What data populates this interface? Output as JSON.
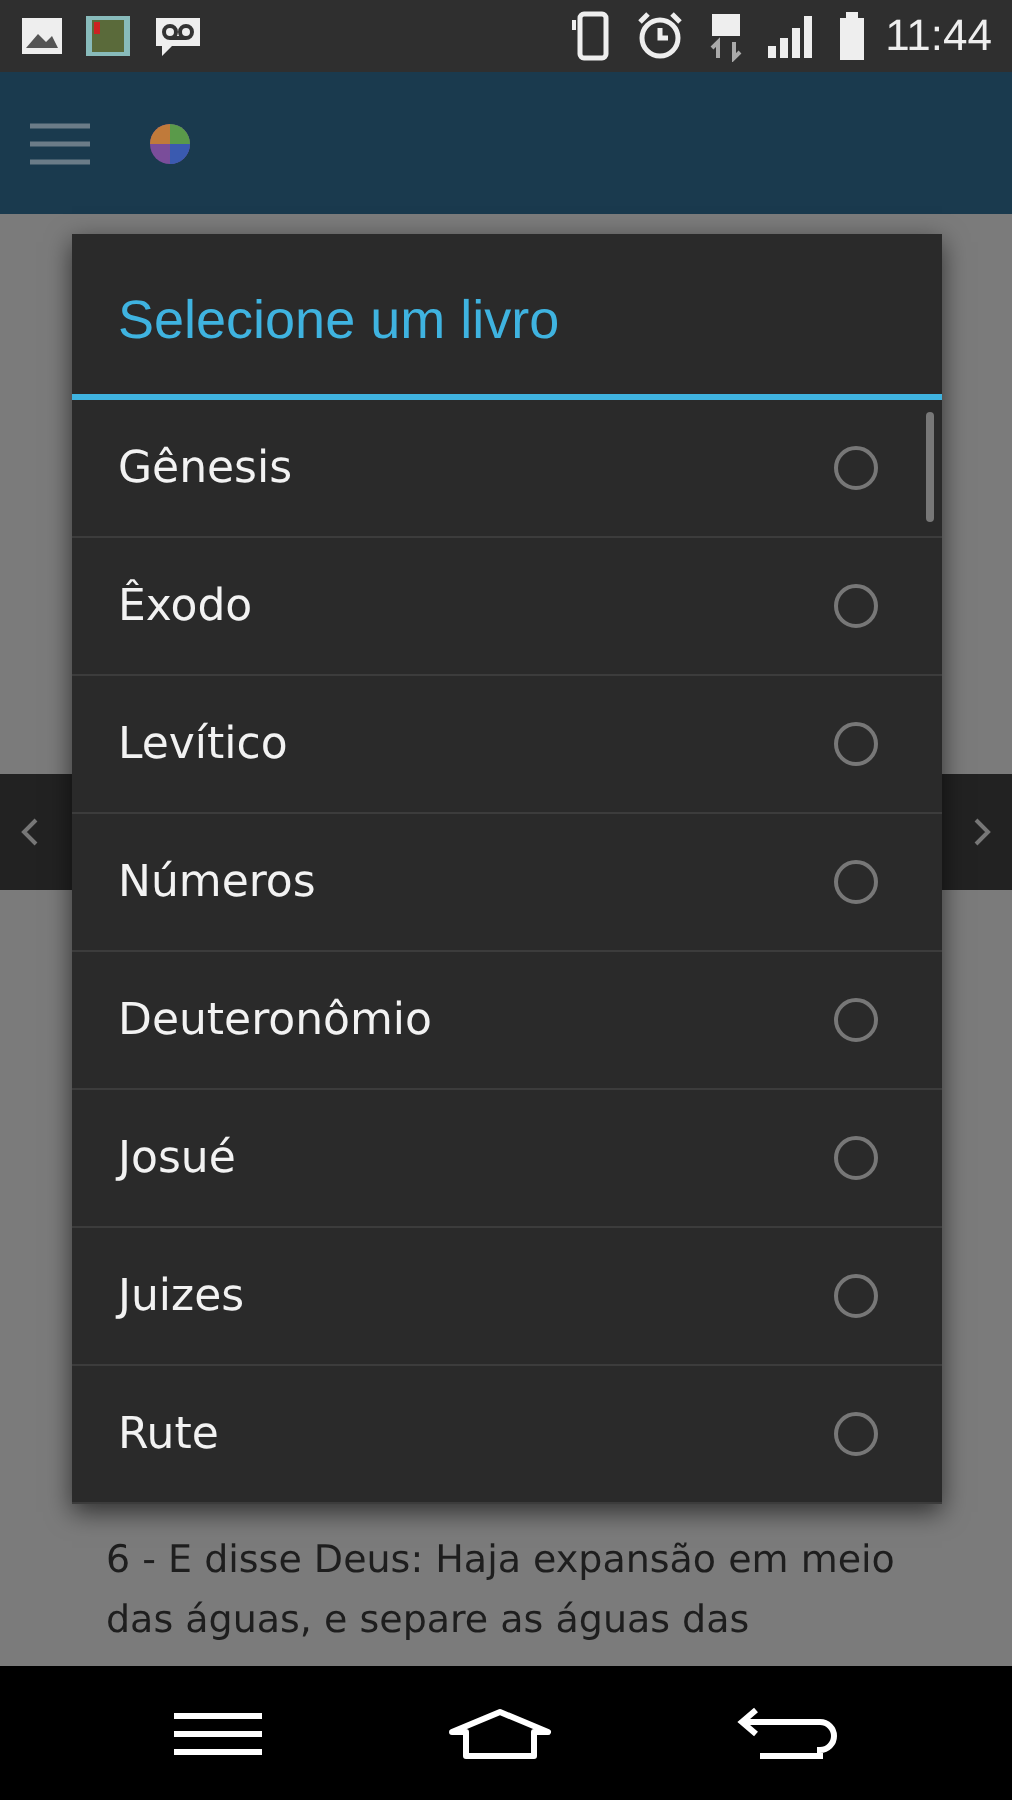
{
  "status_bar": {
    "time": "11:44"
  },
  "dialog": {
    "title": "Selecione um livro",
    "items": [
      {
        "label": "Gênesis",
        "selected": false
      },
      {
        "label": "Êxodo",
        "selected": false
      },
      {
        "label": "Levítico",
        "selected": false
      },
      {
        "label": "Números",
        "selected": false
      },
      {
        "label": "Deuteronômio",
        "selected": false
      },
      {
        "label": "Josué",
        "selected": false
      },
      {
        "label": "Juizes",
        "selected": false
      },
      {
        "label": "Rute",
        "selected": false
      }
    ]
  },
  "verse": {
    "text": "6 - E disse Deus: Haja expansão em meio das águas, e separe as águas das"
  }
}
